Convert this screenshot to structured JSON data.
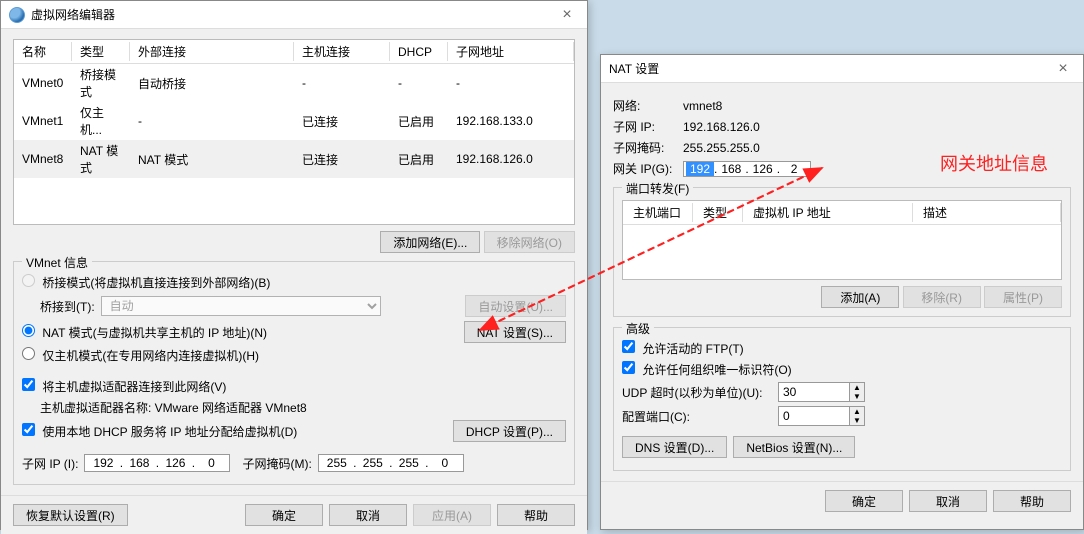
{
  "left": {
    "title": "虚拟网络编辑器",
    "cols": {
      "name": "名称",
      "type": "类型",
      "ext": "外部连接",
      "host": "主机连接",
      "dhcp": "DHCP",
      "subnet": "子网地址"
    },
    "rows": [
      {
        "name": "VMnet0",
        "type": "桥接模式",
        "ext": "自动桥接",
        "host": "-",
        "dhcp": "-",
        "subnet": "-"
      },
      {
        "name": "VMnet1",
        "type": "仅主机...",
        "ext": "-",
        "host": "已连接",
        "dhcp": "已启用",
        "subnet": "192.168.133.0"
      },
      {
        "name": "VMnet8",
        "type": "NAT 模式",
        "ext": "NAT 模式",
        "host": "已连接",
        "dhcp": "已启用",
        "subnet": "192.168.126.0"
      }
    ],
    "addNet": "添加网络(E)...",
    "removeNet": "移除网络(O)",
    "info": {
      "legend": "VMnet 信息",
      "bridge": "桥接模式(将虚拟机直接连接到外部网络)(B)",
      "bridgeTo": "桥接到(T):",
      "bridgeAuto": "自动",
      "bridgeAutoBtn": "自动设置(U)...",
      "nat": "NAT 模式(与虚拟机共享主机的 IP 地址)(N)",
      "natBtn": "NAT 设置(S)...",
      "hostonly": "仅主机模式(在专用网络内连接虚拟机)(H)",
      "connectHost": "将主机虚拟适配器连接到此网络(V)",
      "adapterLabel": "主机虚拟适配器名称: VMware 网络适配器 VMnet8",
      "useDhcp": "使用本地 DHCP 服务将 IP 地址分配给虚拟机(D)",
      "dhcpBtn": "DHCP 设置(P)...",
      "subnetLabel": "子网 IP (I):",
      "subnet": {
        "a": "192",
        "b": "168",
        "c": "126",
        "d": "0"
      },
      "maskLabel": "子网掩码(M):",
      "mask": {
        "a": "255",
        "b": "255",
        "c": "255",
        "d": "0"
      }
    },
    "restore": "恢复默认设置(R)",
    "ok": "确定",
    "cancel": "取消",
    "apply": "应用(A)",
    "help": "帮助"
  },
  "right": {
    "title": "NAT 设置",
    "netLabel": "网络:",
    "netVal": "vmnet8",
    "subLabel": "子网 IP:",
    "subVal": "192.168.126.0",
    "maskLabel": "子网掩码:",
    "maskVal": "255.255.255.0",
    "gwLabel": "网关 IP(G):",
    "gw": {
      "a": "192",
      "b": "168",
      "c": "126",
      "d": "2"
    },
    "portFwd": "端口转发(F)",
    "cols": {
      "hostPort": "主机端口",
      "type": "类型",
      "vmip": "虚拟机 IP 地址",
      "desc": "描述"
    },
    "add": "添加(A)",
    "remove": "移除(R)",
    "props": "属性(P)",
    "advanced": "高级",
    "ftp": "允许活动的 FTP(T)",
    "anyorg": "允许任何组织唯一标识符(O)",
    "udpLabel": "UDP 超时(以秒为单位)(U):",
    "udpVal": "30",
    "cfgPortLabel": "配置端口(C):",
    "cfgPortVal": "0",
    "dnsBtn": "DNS 设置(D)...",
    "nbBtn": "NetBios 设置(N)...",
    "ok": "确定",
    "cancel": "取消",
    "help": "帮助"
  },
  "annot": "网关地址信息"
}
